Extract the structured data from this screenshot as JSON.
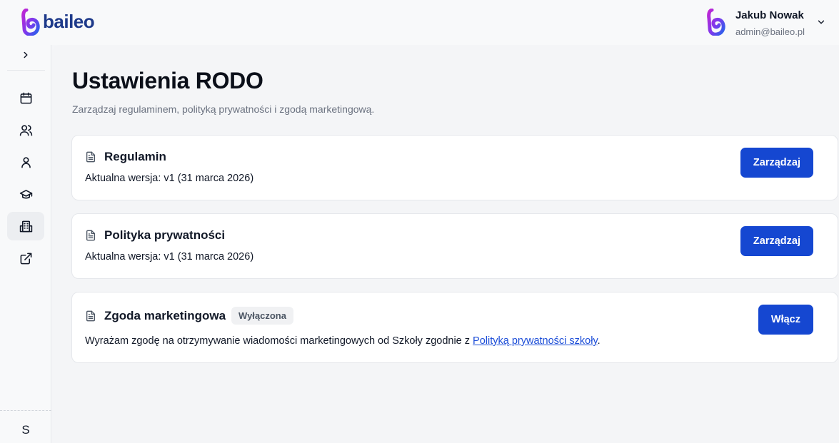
{
  "brand": {
    "name": "baileo"
  },
  "user": {
    "name": "Jakub Nowak",
    "email": "admin@baileo.pl"
  },
  "sidebar": {
    "items": [
      {
        "icon": "calendar-icon"
      },
      {
        "icon": "users-icon"
      },
      {
        "icon": "user-icon"
      },
      {
        "icon": "graduation-cap-icon"
      },
      {
        "icon": "building-icon",
        "active": true
      },
      {
        "icon": "external-link-icon"
      }
    ],
    "footer_initial": "S"
  },
  "page": {
    "title": "Ustawienia RODO",
    "subtitle": "Zarządzaj regulaminem, polityką prywatności i zgodą marketingową."
  },
  "cards": [
    {
      "title": "Regulamin",
      "description": "Aktualna wersja: v1 (31 marca 2026)",
      "button": "Zarządzaj"
    },
    {
      "title": "Polityka prywatności",
      "description": "Aktualna wersja: v1 (31 marca 2026)",
      "button": "Zarządzaj"
    },
    {
      "title": "Zgoda marketingowa",
      "badge": "Wyłączona",
      "description_prefix": "Wyrażam zgodę na otrzymywanie wiadomości marketingowych od Szkoły zgodnie z ",
      "link": "Polityką prywatności szkoły",
      "description_suffix": ".",
      "button": "Włącz"
    }
  ],
  "colors": {
    "primary": "#1547d1",
    "link": "#1d4ed8",
    "brand": "#1e3a8a"
  }
}
